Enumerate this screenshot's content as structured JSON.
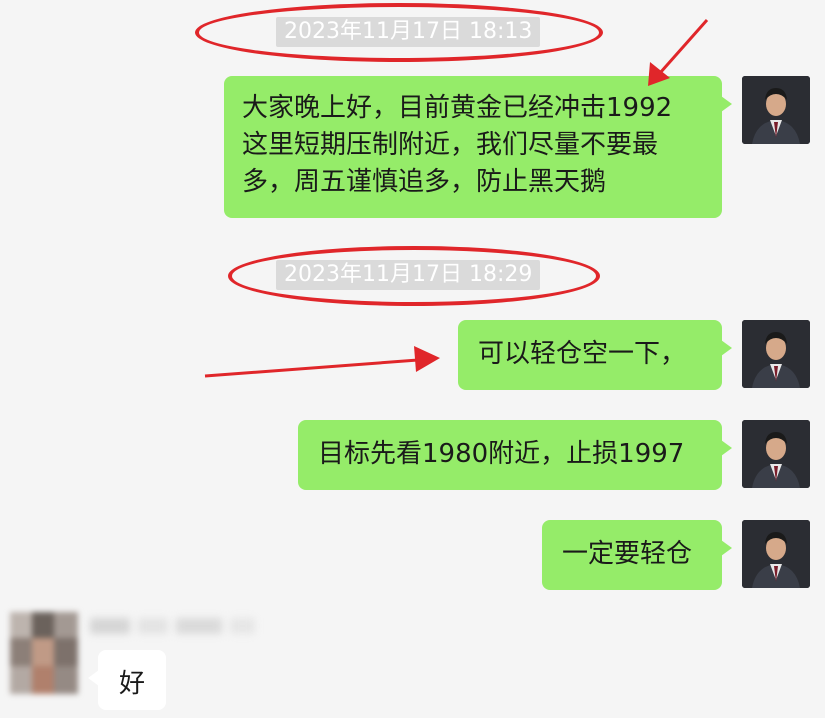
{
  "colors": {
    "background": "#f5f5f5",
    "sent_bubble": "#95ec69",
    "received_bubble": "#ffffff",
    "timestamp_bg": "#dadada",
    "annotation_red": "#e0262a"
  },
  "chat": {
    "timestamps": [
      "2023年11月17日 18:13",
      "2023年11月17日 18:29"
    ],
    "messages": [
      {
        "sender": "self",
        "lines": [
          "大家晚上好，目前黄金已经冲击1992",
          "这里短期压制附近，我们尽量不要最",
          "多，周五谨慎追多，防止黑天鹅"
        ]
      },
      {
        "sender": "self",
        "text": "可以轻仓空一下，"
      },
      {
        "sender": "self",
        "text": "目标先看1980附近，止损1997"
      },
      {
        "sender": "self",
        "text": "一定要轻仓"
      },
      {
        "sender": "other",
        "text": "好"
      }
    ]
  },
  "icons": {
    "self_avatar": "man-in-suit-avatar",
    "other_avatar": "blurred-avatar"
  }
}
